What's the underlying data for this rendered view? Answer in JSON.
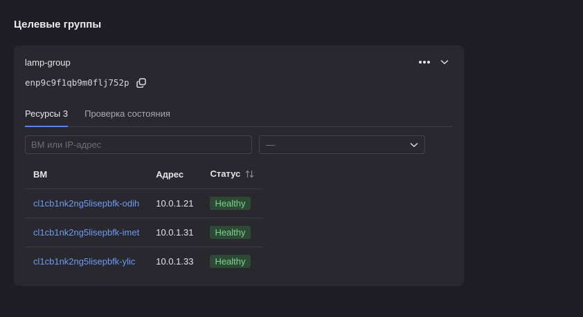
{
  "section": {
    "title": "Целевые группы"
  },
  "group": {
    "name": "lamp-group",
    "id": "enp9c9f1qb9m0flj752p"
  },
  "tabs": [
    {
      "label": "Ресурсы 3",
      "active": true
    },
    {
      "label": "Проверка состояния",
      "active": false
    }
  ],
  "filters": {
    "search_placeholder": "ВМ или IP-адрес",
    "select_value": "—"
  },
  "table": {
    "columns": [
      "ВМ",
      "Адрес",
      "Статус"
    ],
    "rows": [
      {
        "vm": "cl1cb1nk2ng5lisepbfk-odih",
        "address": "10.0.1.21",
        "status": "Healthy"
      },
      {
        "vm": "cl1cb1nk2ng5lisepbfk-imet",
        "address": "10.0.1.31",
        "status": "Healthy"
      },
      {
        "vm": "cl1cb1nk2ng5lisepbfk-ylic",
        "address": "10.0.1.33",
        "status": "Healthy"
      }
    ]
  },
  "icons": {
    "copy": "copy-icon",
    "more": "more-horizontal-icon",
    "expand": "chevron-down-icon",
    "select": "chevron-down-icon",
    "sort": "sort-arrows-icon"
  },
  "colors": {
    "accent": "#5282ff",
    "link": "#6d9cf5",
    "status_healthy_bg": "#2c4a34",
    "status_healthy_text": "#7fd38e"
  }
}
